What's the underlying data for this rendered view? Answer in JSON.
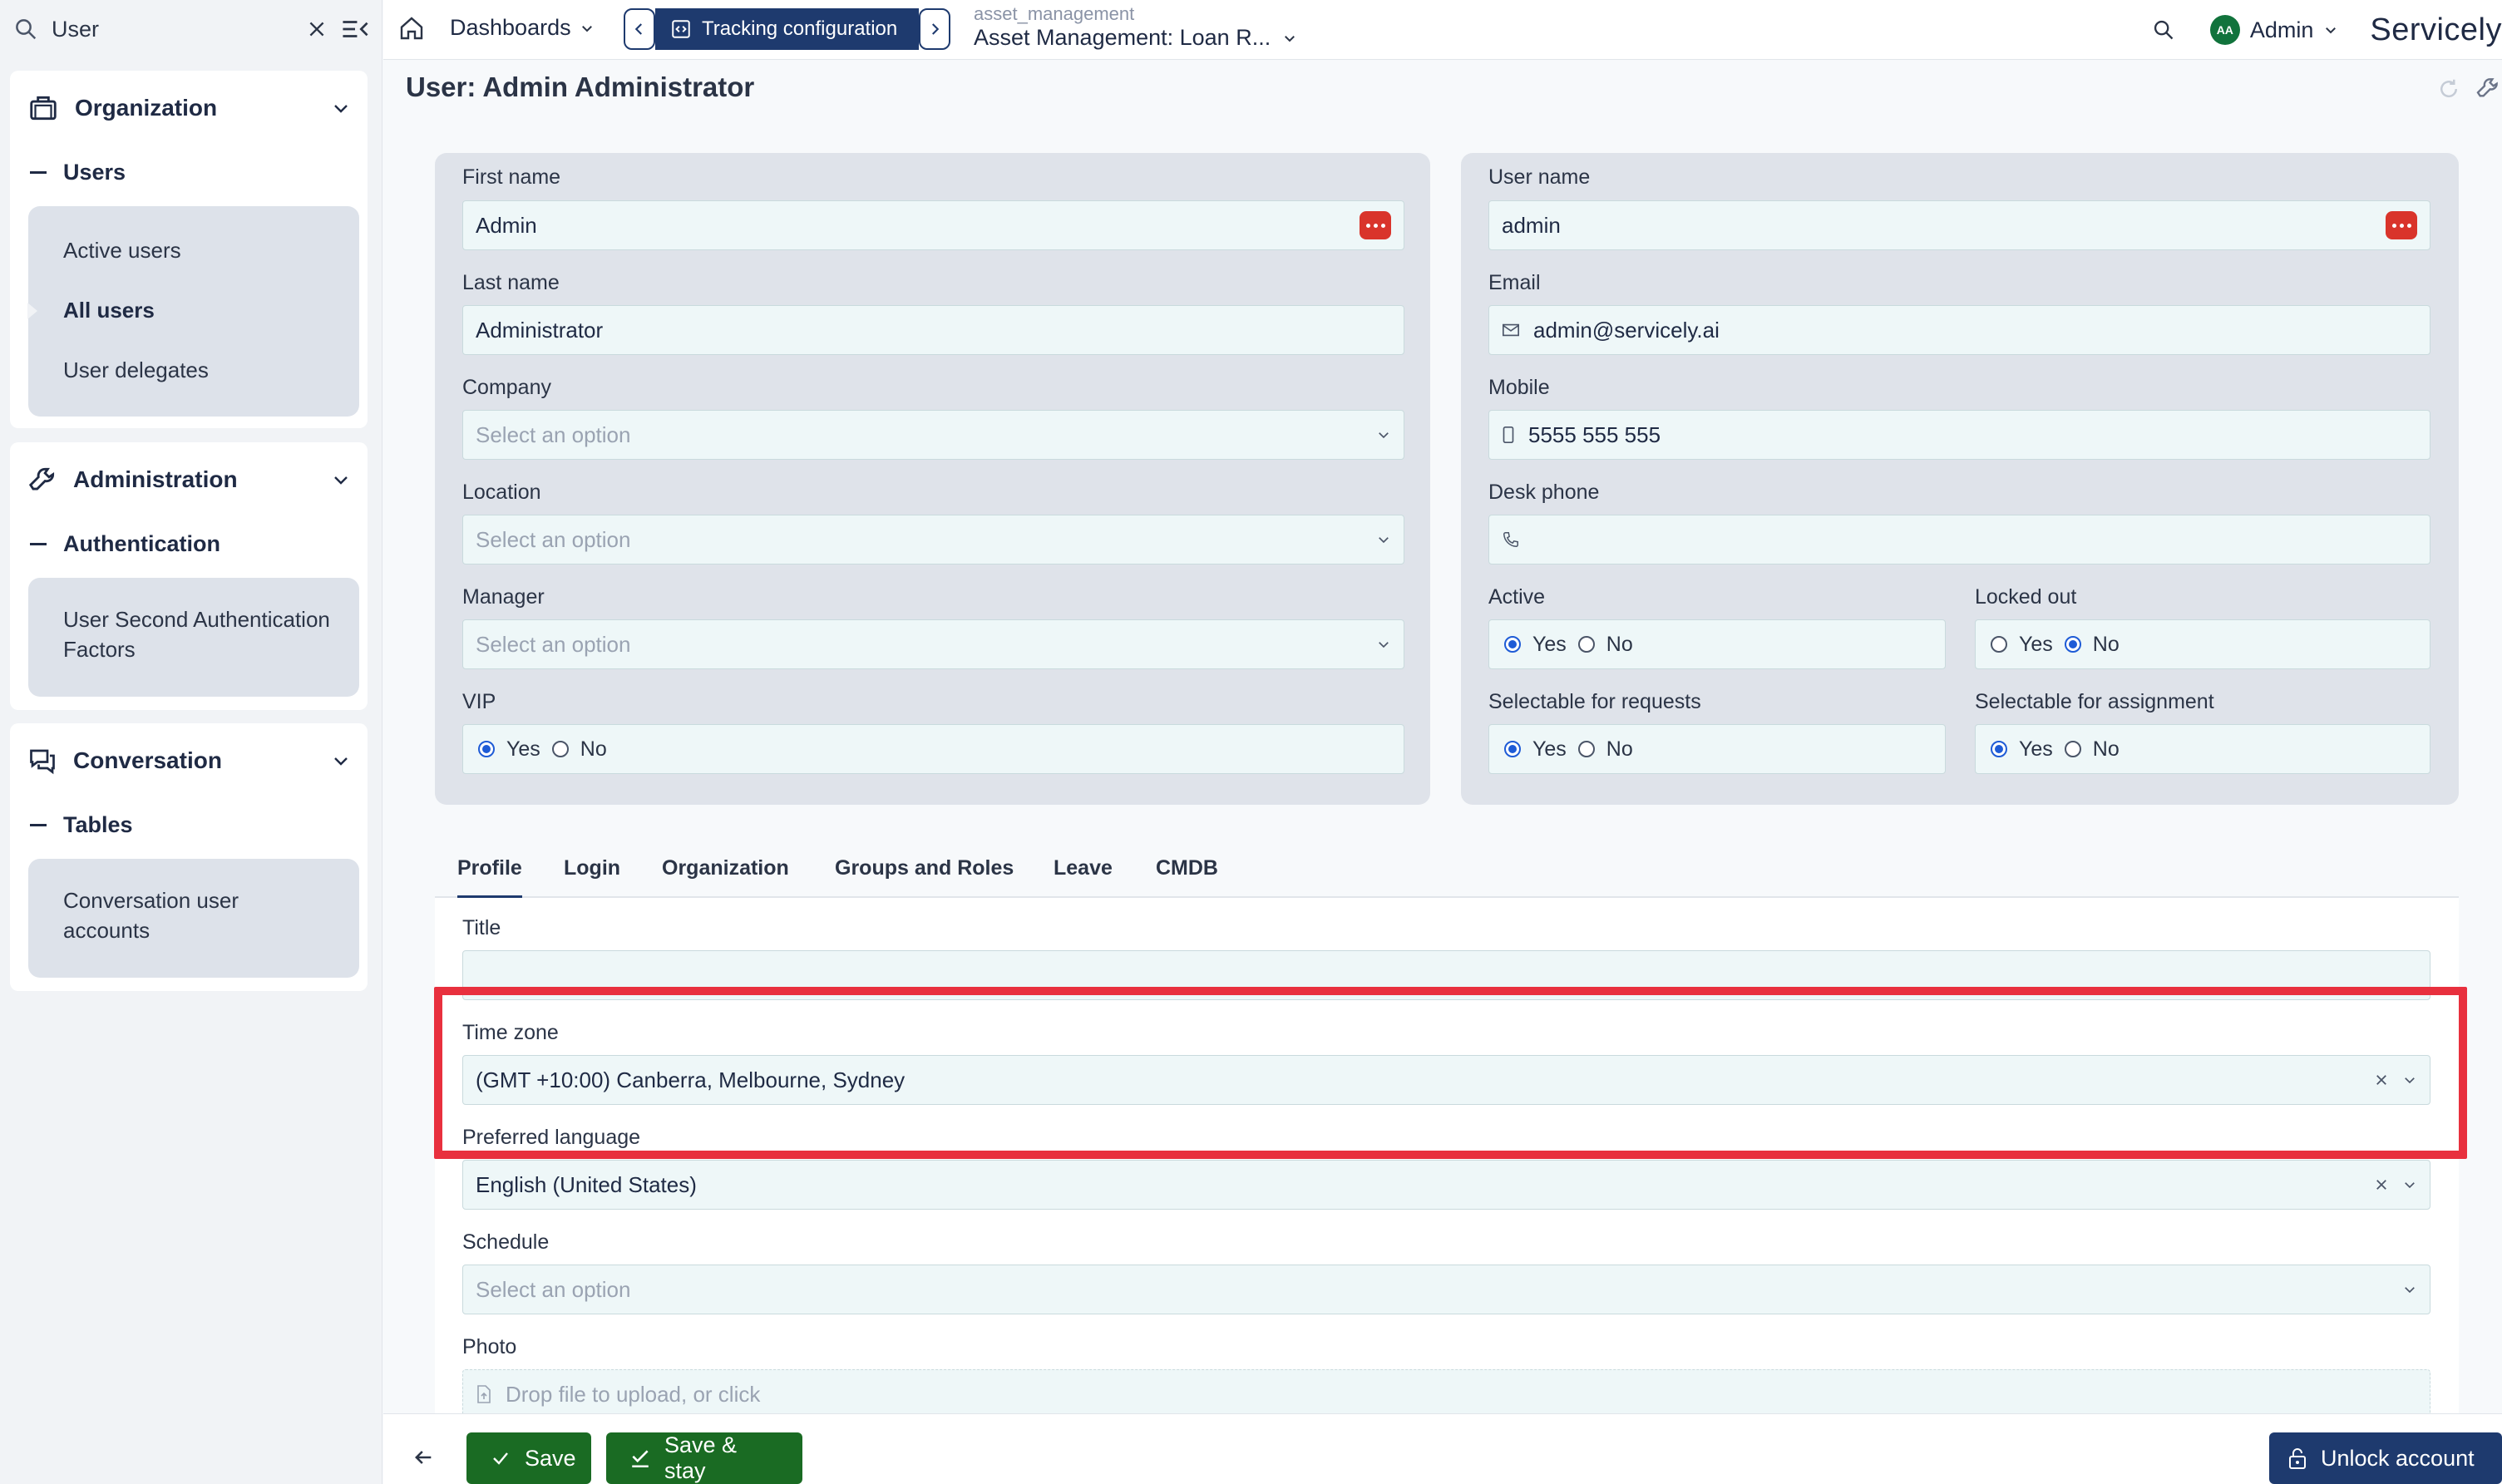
{
  "sidebar": {
    "search_value": "User",
    "sections": [
      {
        "title": "Organization",
        "subtitle": "Users",
        "items": [
          "Active users",
          "All users",
          "User delegates"
        ]
      },
      {
        "title": "Administration",
        "subtitle": "Authentication",
        "items": [
          "User Second Authentication Factors"
        ]
      },
      {
        "title": "Conversation",
        "subtitle": "Tables",
        "items": [
          "Conversation user accounts"
        ]
      }
    ],
    "active_item": "All users"
  },
  "topbar": {
    "dashboards_label": "Dashboards",
    "tracking_label": "Tracking configuration",
    "project_small": "asset_management",
    "project_big": "Asset Management: Loan R...",
    "user_initials": "AA",
    "user_label": "Admin",
    "brand": "Servicely"
  },
  "page": {
    "title": "User: Admin Administrator"
  },
  "left_panel": {
    "first_name_label": "First name",
    "first_name_value": "Admin",
    "last_name_label": "Last name",
    "last_name_value": "Administrator",
    "company_label": "Company",
    "location_label": "Location",
    "manager_label": "Manager",
    "select_placeholder": "Select an option",
    "vip_label": "VIP",
    "vip_value": "Yes"
  },
  "right_panel": {
    "username_label": "User name",
    "username_value": "admin",
    "email_label": "Email",
    "email_value": "admin@servicely.ai",
    "mobile_label": "Mobile",
    "mobile_value": "5555 555 555",
    "desk_label": "Desk phone",
    "desk_value": "",
    "active_label": "Active",
    "active_value": "Yes",
    "locked_label": "Locked out",
    "locked_value": "No",
    "sel_req_label": "Selectable for requests",
    "sel_req_value": "Yes",
    "sel_assign_label": "Selectable for assignment",
    "sel_assign_value": "Yes"
  },
  "radio_labels": {
    "yes": "Yes",
    "no": "No"
  },
  "tabs": [
    "Profile",
    "Login",
    "Organization",
    "Groups and Roles",
    "Leave",
    "CMDB"
  ],
  "active_tab": "Profile",
  "profile": {
    "title_label": "Title",
    "title_value": "",
    "timezone_label": "Time zone",
    "timezone_value": "(GMT +10:00) Canberra, Melbourne, Sydney",
    "language_label": "Preferred language",
    "language_value": "English (United States)",
    "schedule_label": "Schedule",
    "schedule_placeholder": "Select an option",
    "photo_label": "Photo",
    "photo_placeholder": "Drop file to upload, or click"
  },
  "footer": {
    "save_label": "Save",
    "save_stay_label": "Save & stay",
    "unlock_label": "Unlock account"
  },
  "colors": {
    "primary": "#1e3a6e",
    "save_green": "#1a6b23",
    "highlight_red": "#e8303e",
    "password_red": "#d9342b"
  }
}
